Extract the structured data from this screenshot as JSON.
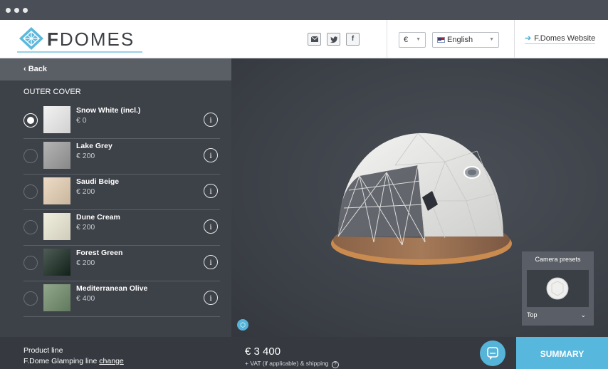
{
  "brand": {
    "strong": "F",
    "rest": "DOMES"
  },
  "header": {
    "currency": "€",
    "language": "English",
    "website_link": "F.Domes Website"
  },
  "sidebar": {
    "back_label": "‹ Back",
    "section_title": "OUTER COVER",
    "options": [
      {
        "name": "Snow White (incl.)",
        "price": "€ 0",
        "color": "#eeeeee",
        "selected": true
      },
      {
        "name": "Lake Grey",
        "price": "€ 200",
        "color": "#9b9b9b",
        "selected": false
      },
      {
        "name": "Saudi Beige",
        "price": "€ 200",
        "color": "#e6cfb3",
        "selected": false
      },
      {
        "name": "Dune Cream",
        "price": "€ 200",
        "color": "#ece9d4",
        "selected": false
      },
      {
        "name": "Forest Green",
        "price": "€ 200",
        "color": "#13261c",
        "selected": false
      },
      {
        "name": "Mediterranean Olive",
        "price": "€ 400",
        "color": "#6e8a68",
        "selected": false
      }
    ]
  },
  "bottom": {
    "product_line_label": "Product line",
    "product_line_value": "F.Dome Glamping line",
    "change_label": "change",
    "price": "€ 3 400",
    "vat_note": "+ VAT (if applicable) & shipping",
    "vat_help": "?",
    "summary_label": "SUMMARY"
  },
  "camera_presets": {
    "title": "Camera presets",
    "selected": "Top"
  },
  "colors": {
    "accent": "#58b7dd",
    "sidebar_bg": "#3d4148",
    "back_bar": "#5a5e65"
  }
}
